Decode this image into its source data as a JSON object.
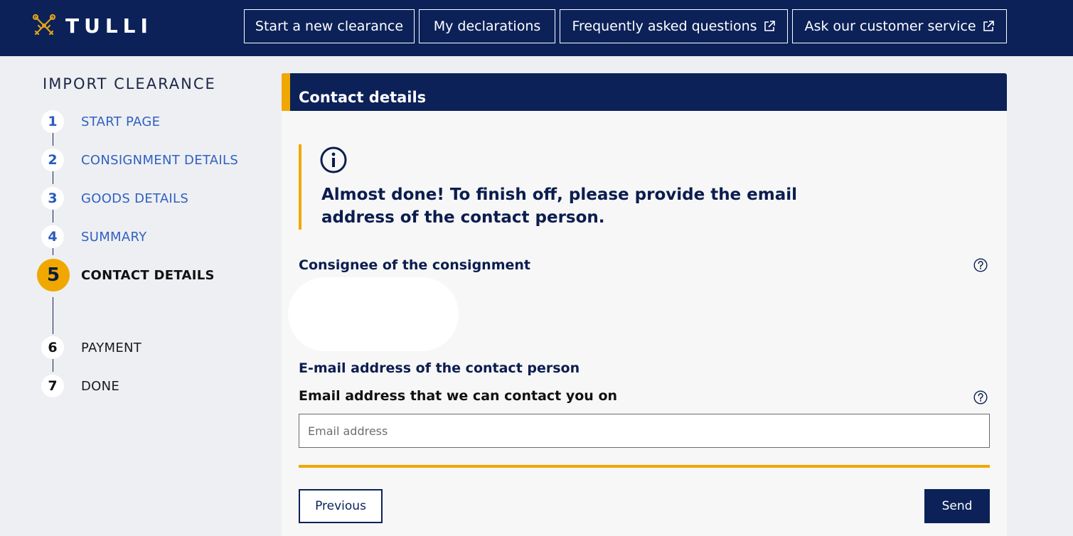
{
  "brand": {
    "name": "TULLI",
    "logo_icon": "crossed-keys-icon",
    "accent_color": "#f0a800",
    "primary_color": "#0b2158"
  },
  "nav": {
    "items": [
      {
        "label": "Start a new clearance",
        "external": false
      },
      {
        "label": "My declarations",
        "external": false
      },
      {
        "label": "Frequently asked questions",
        "external": true
      },
      {
        "label": "Ask our customer service",
        "external": true
      }
    ]
  },
  "sidebar": {
    "title": "IMPORT CLEARANCE",
    "steps": [
      {
        "number": "1",
        "label": "START PAGE",
        "state": "done"
      },
      {
        "number": "2",
        "label": "CONSIGNMENT DETAILS",
        "state": "done"
      },
      {
        "number": "3",
        "label": "GOODS DETAILS",
        "state": "done"
      },
      {
        "number": "4",
        "label": "SUMMARY",
        "state": "done"
      },
      {
        "number": "5",
        "label": "CONTACT DETAILS",
        "state": "current"
      },
      {
        "number": "6",
        "label": "PAYMENT",
        "state": "future"
      },
      {
        "number": "7",
        "label": "DONE",
        "state": "future"
      }
    ]
  },
  "main": {
    "title": "Contact details",
    "notice": {
      "icon": "info-icon",
      "text": "Almost done! To finish off, please provide the email address of the contact person."
    },
    "consignee_label": "Consignee of the consignment",
    "email_section_label": "E-mail address of the contact person",
    "email_field": {
      "label": "Email address that we can contact you on",
      "value": "",
      "placeholder": "Email address"
    },
    "previous_label": "Previous",
    "send_label": "Send"
  }
}
